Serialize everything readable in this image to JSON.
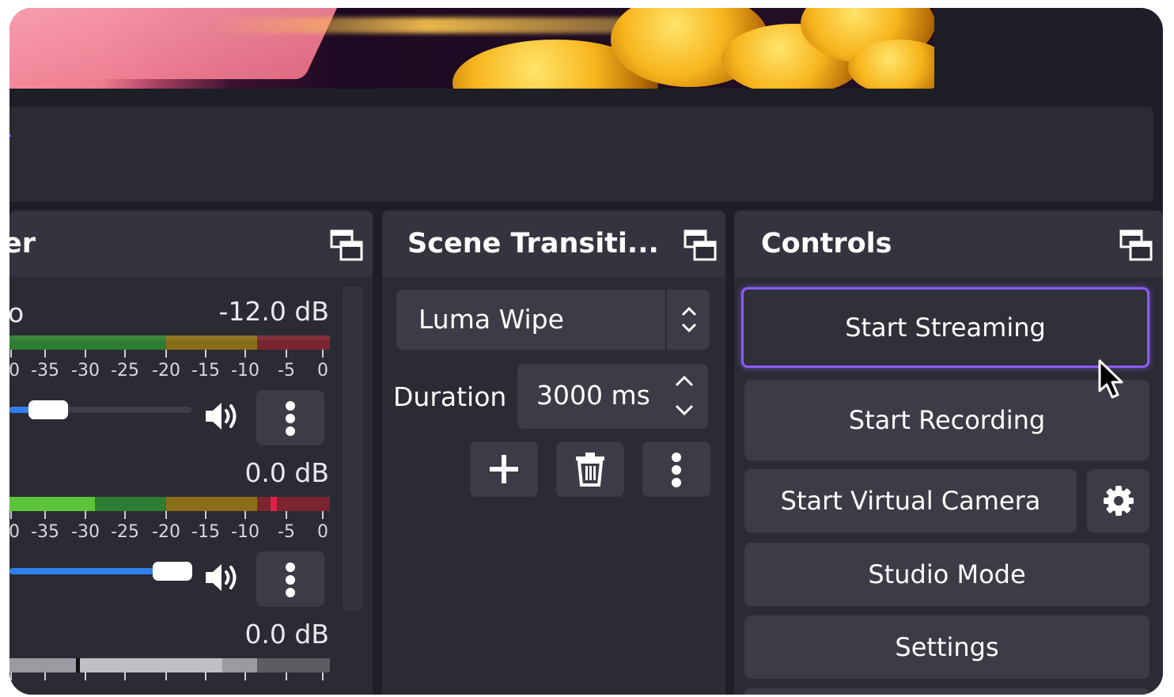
{
  "audio_mixer": {
    "title_fragment": "er",
    "channels": [
      {
        "name_fragment": "o",
        "db": "-12.0 dB",
        "scale": [
          "0",
          "-35",
          "-30",
          "-25",
          "-20",
          "-15",
          "-10",
          "-5",
          "0"
        ],
        "volume": 0.2
      },
      {
        "name_fragment": "",
        "db": "0.0 dB",
        "scale": [
          "0",
          "-35",
          "-30",
          "-25",
          "-20",
          "-15",
          "-10",
          "-5",
          "0"
        ],
        "volume": 1.0
      },
      {
        "name_fragment": "",
        "db": "0.0 dB"
      }
    ]
  },
  "scene_transitions": {
    "title": "Scene Transiti...",
    "transition": "Luma Wipe",
    "duration_label": "Duration",
    "duration_value": "3000 ms"
  },
  "controls": {
    "title": "Controls",
    "start_streaming": "Start Streaming",
    "start_recording": "Start Recording",
    "start_virtual_camera": "Start Virtual Camera",
    "studio_mode": "Studio Mode",
    "settings": "Settings"
  },
  "colors": {
    "background": "#1e1f26",
    "dock": "#2a2b33",
    "button": "#3b3c46",
    "accent": "#8b5cf6",
    "slider": "#2f80ed"
  },
  "icons": [
    "undock-icon",
    "speaker-icon",
    "kebab-menu-icon",
    "plus-icon",
    "trash-icon",
    "gear-icon",
    "mouse-cursor-icon",
    "updown-chevron-icon"
  ]
}
